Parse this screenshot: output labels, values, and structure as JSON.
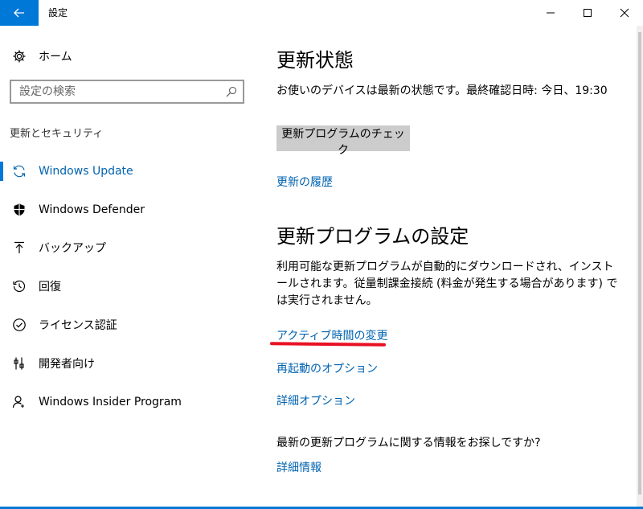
{
  "window": {
    "title": "設定"
  },
  "sidebar": {
    "home_label": "ホーム",
    "search_placeholder": "設定の検索",
    "section_title": "更新とセキュリティ",
    "items": [
      {
        "label": "Windows Update",
        "icon": "sync-icon",
        "active": true
      },
      {
        "label": "Windows Defender",
        "icon": "shield-icon",
        "active": false
      },
      {
        "label": "バックアップ",
        "icon": "backup-arrow-icon",
        "active": false
      },
      {
        "label": "回復",
        "icon": "history-icon",
        "active": false
      },
      {
        "label": "ライセンス認証",
        "icon": "check-circle-icon",
        "active": false
      },
      {
        "label": "開発者向け",
        "icon": "developer-icon",
        "active": false
      },
      {
        "label": "Windows Insider Program",
        "icon": "person-icon",
        "active": false
      }
    ]
  },
  "main": {
    "status_heading": "更新状態",
    "status_text": "お使いのデバイスは最新の状態です。最終確認日時: 今日、19:30",
    "check_button": "更新プログラムのチェック",
    "history_link": "更新の履歴",
    "settings_heading": "更新プログラムの設定",
    "settings_text": "利用可能な更新プログラムが自動的にダウンロードされ、インストールされます。従量制課金接続 (料金が発生する場合があります) では実行されません。",
    "active_hours_link": "アクティブ時間の変更",
    "restart_link": "再起動のオプション",
    "advanced_link": "詳細オプション",
    "info_question": "最新の更新プログラムに関する情報をお探しですか?",
    "info_link": "詳細情報"
  },
  "colors": {
    "accent": "#0078d7",
    "link": "#0063b1",
    "annotation": "#e81123"
  }
}
